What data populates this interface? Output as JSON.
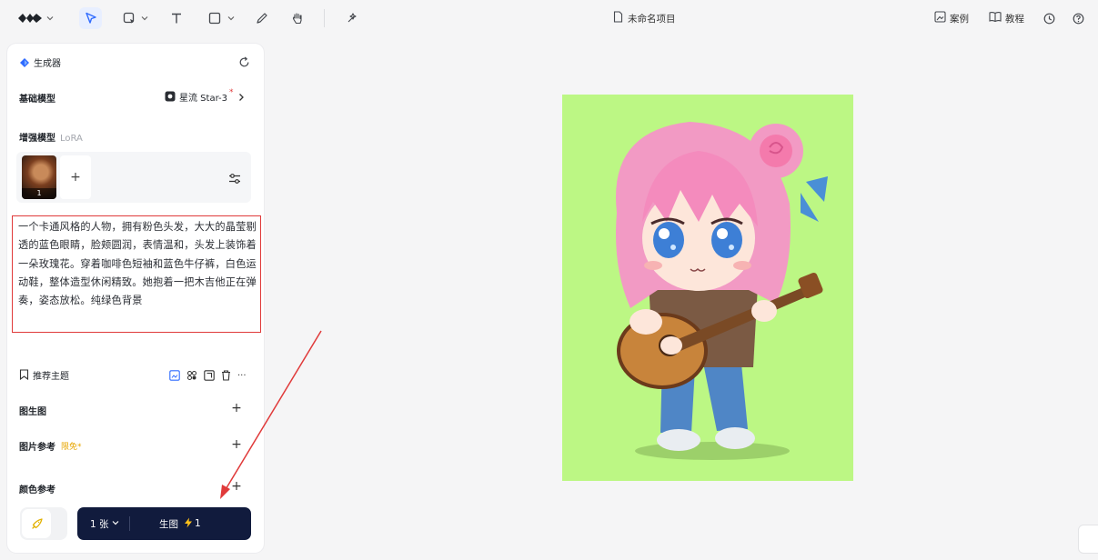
{
  "toolbar": {
    "tools": [
      "logo-menu",
      "select-tool",
      "frame-tool",
      "text-tool",
      "shape-tool",
      "pen-tool",
      "hand-tool",
      "magic-tool"
    ],
    "active_tool": "select-tool",
    "doc_title": "未命名项目",
    "cases_label": "案例",
    "tutorial_label": "教程"
  },
  "panel": {
    "title": "生成器",
    "base_model_label": "基础模型",
    "base_model_value": "星流 Star-3",
    "base_model_badge": "*",
    "lora_label": "增强模型",
    "lora_sub": "LoRA",
    "lora_count": "1",
    "lora_add": "+",
    "prompt": "一个卡通风格的人物，拥有粉色头发，大大的晶莹剔透的蓝色眼睛，脸颊圆润，表情温和，头发上装饰着一朵玫瑰花。穿着咖啡色短袖和蓝色牛仔裤，白色运动鞋，整体造型休闲精致。她抱着一把木吉他正在弹奏，姿态放松。纯绿色背景",
    "recommend_label": "推荐主题",
    "img2img_label": "图生图",
    "image_ref_label": "图片参考",
    "image_ref_badge": "限免*",
    "color_ref_label": "颜色参考",
    "add_symbol": "+",
    "more_symbol": "···"
  },
  "generate": {
    "count_label": "1 张",
    "button_label": "生图",
    "cost": "1"
  },
  "colors": {
    "accent": "#2f6bff",
    "generate_bg": "#111b3d",
    "prompt_border": "#e03a3a",
    "annotation_arrow": "#e03a3a",
    "canvas_bg": "#bcf784",
    "badge": "#e7a600"
  },
  "icons": [
    "logo-icon",
    "cursor-icon",
    "frame-icon",
    "text-icon",
    "square-icon",
    "pen-icon",
    "hand-icon",
    "magic-icon",
    "file-icon",
    "gallery-icon",
    "book-icon",
    "clock-icon",
    "help-icon",
    "diamond-icon",
    "refresh-icon",
    "model-icon",
    "chevron-right-icon",
    "sliders-icon",
    "bookmark-icon",
    "image-add-icon",
    "palette-icon",
    "crop-icon",
    "trash-icon",
    "rocket-icon",
    "bolt-icon",
    "chevron-down-icon"
  ]
}
